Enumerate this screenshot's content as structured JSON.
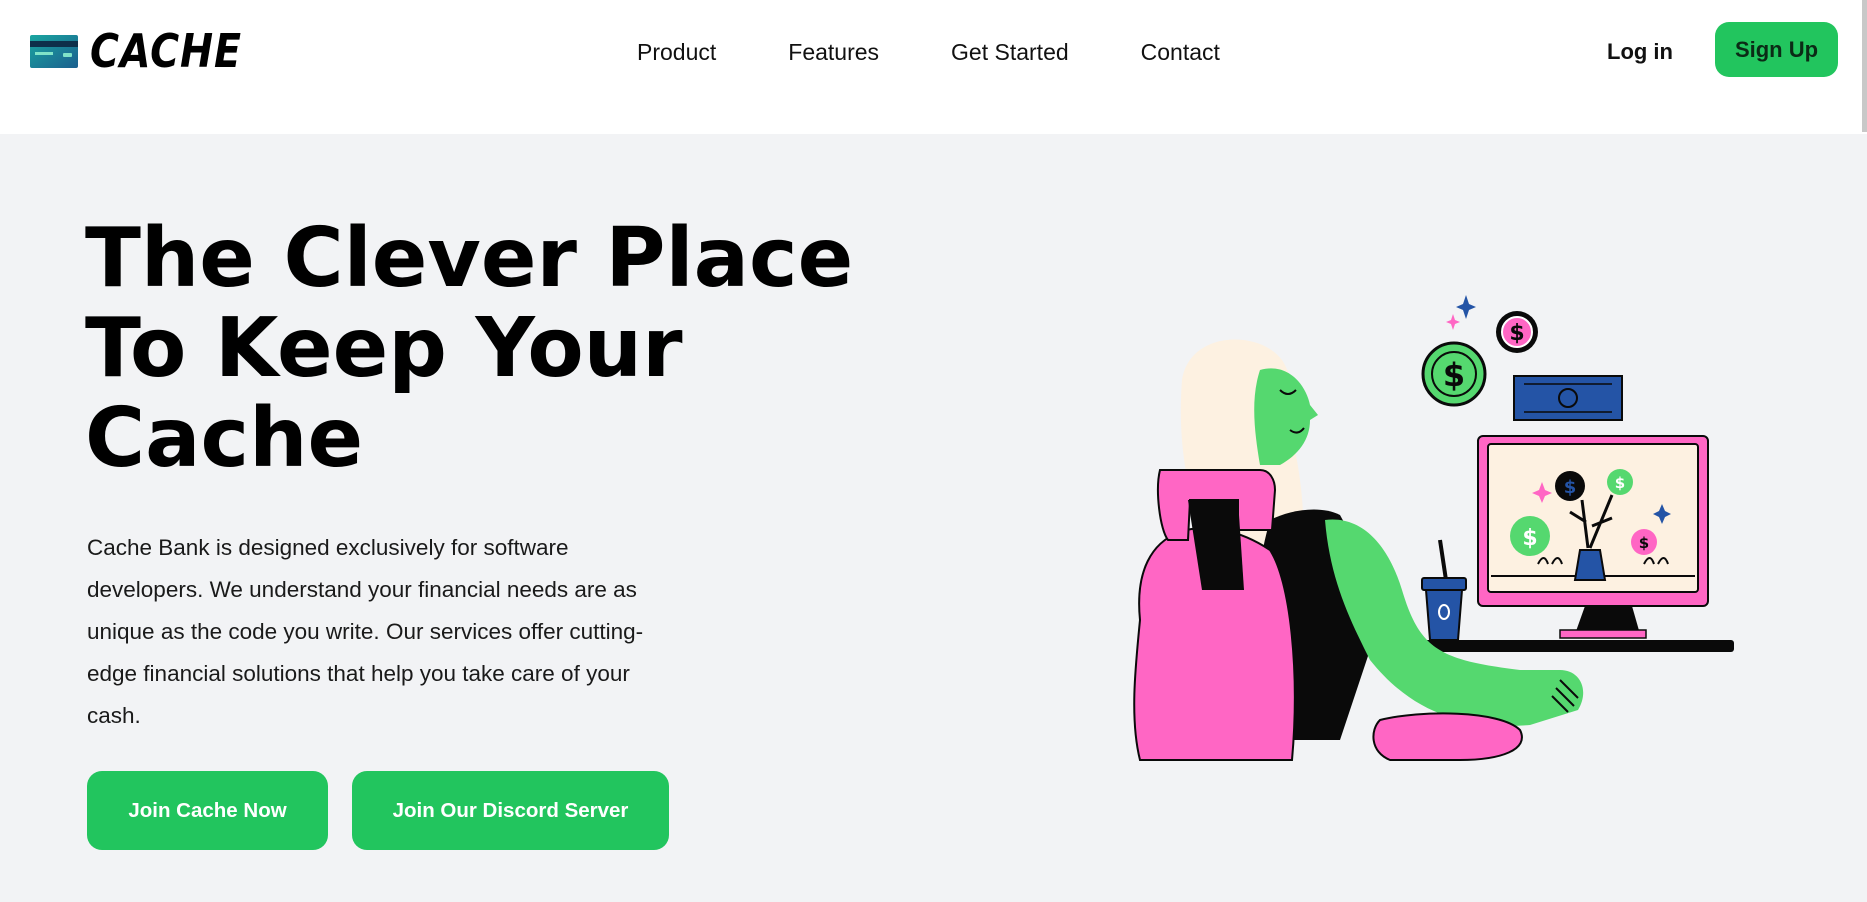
{
  "brand": {
    "name": "CACHE"
  },
  "nav": {
    "links": [
      "Product",
      "Features",
      "Get Started",
      "Contact"
    ],
    "login_label": "Log in",
    "signup_label": "Sign Up"
  },
  "hero": {
    "title_lines": [
      "The Clever Place",
      "To Keep Your",
      "Cache"
    ],
    "description": "Cache Bank is designed exclusively for software developers. We understand your financial needs are as unique as the code you write. Our services offer cutting-edge financial solutions that help you take care of your cash.",
    "cta_primary": "Join Cache Now",
    "cta_secondary": "Join Our Discord Server"
  },
  "icons": {
    "logo": "credit-card-icon",
    "illustration": "woman-at-computer-illustration"
  },
  "colors": {
    "accent_green": "#22c55e",
    "illustration_pink": "#ff66c4",
    "illustration_green": "#55d86f",
    "illustration_blue": "#2454a6",
    "illustration_cream": "#fdf1e1",
    "background": "#f2f3f5"
  }
}
